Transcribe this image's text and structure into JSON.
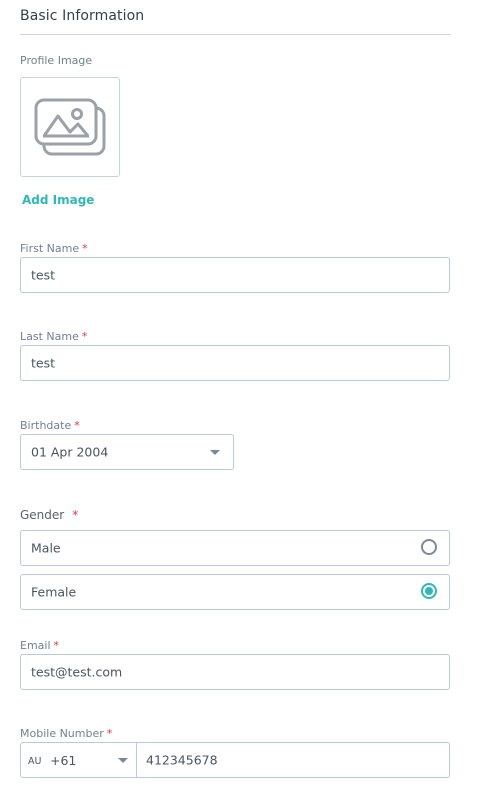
{
  "section": {
    "title": "Basic Information"
  },
  "profile_image": {
    "label": "Profile Image",
    "add_label": "Add Image"
  },
  "required_marker": "*",
  "first_name": {
    "label": "First Name",
    "value": "test"
  },
  "last_name": {
    "label": "Last Name",
    "value": "test"
  },
  "birthdate": {
    "label": "Birthdate",
    "value": "01 Apr 2004"
  },
  "gender": {
    "label": "Gender",
    "options": [
      {
        "label": "Male",
        "selected": false
      },
      {
        "label": "Female",
        "selected": true
      }
    ]
  },
  "email": {
    "label": "Email",
    "value": "test@test.com"
  },
  "mobile": {
    "label": "Mobile Number",
    "country": "AU",
    "dial_code": "+61",
    "number": "412345678"
  },
  "colors": {
    "accent": "#2fb8b8",
    "required": "#e0364c",
    "border": "#b8cbdc"
  }
}
